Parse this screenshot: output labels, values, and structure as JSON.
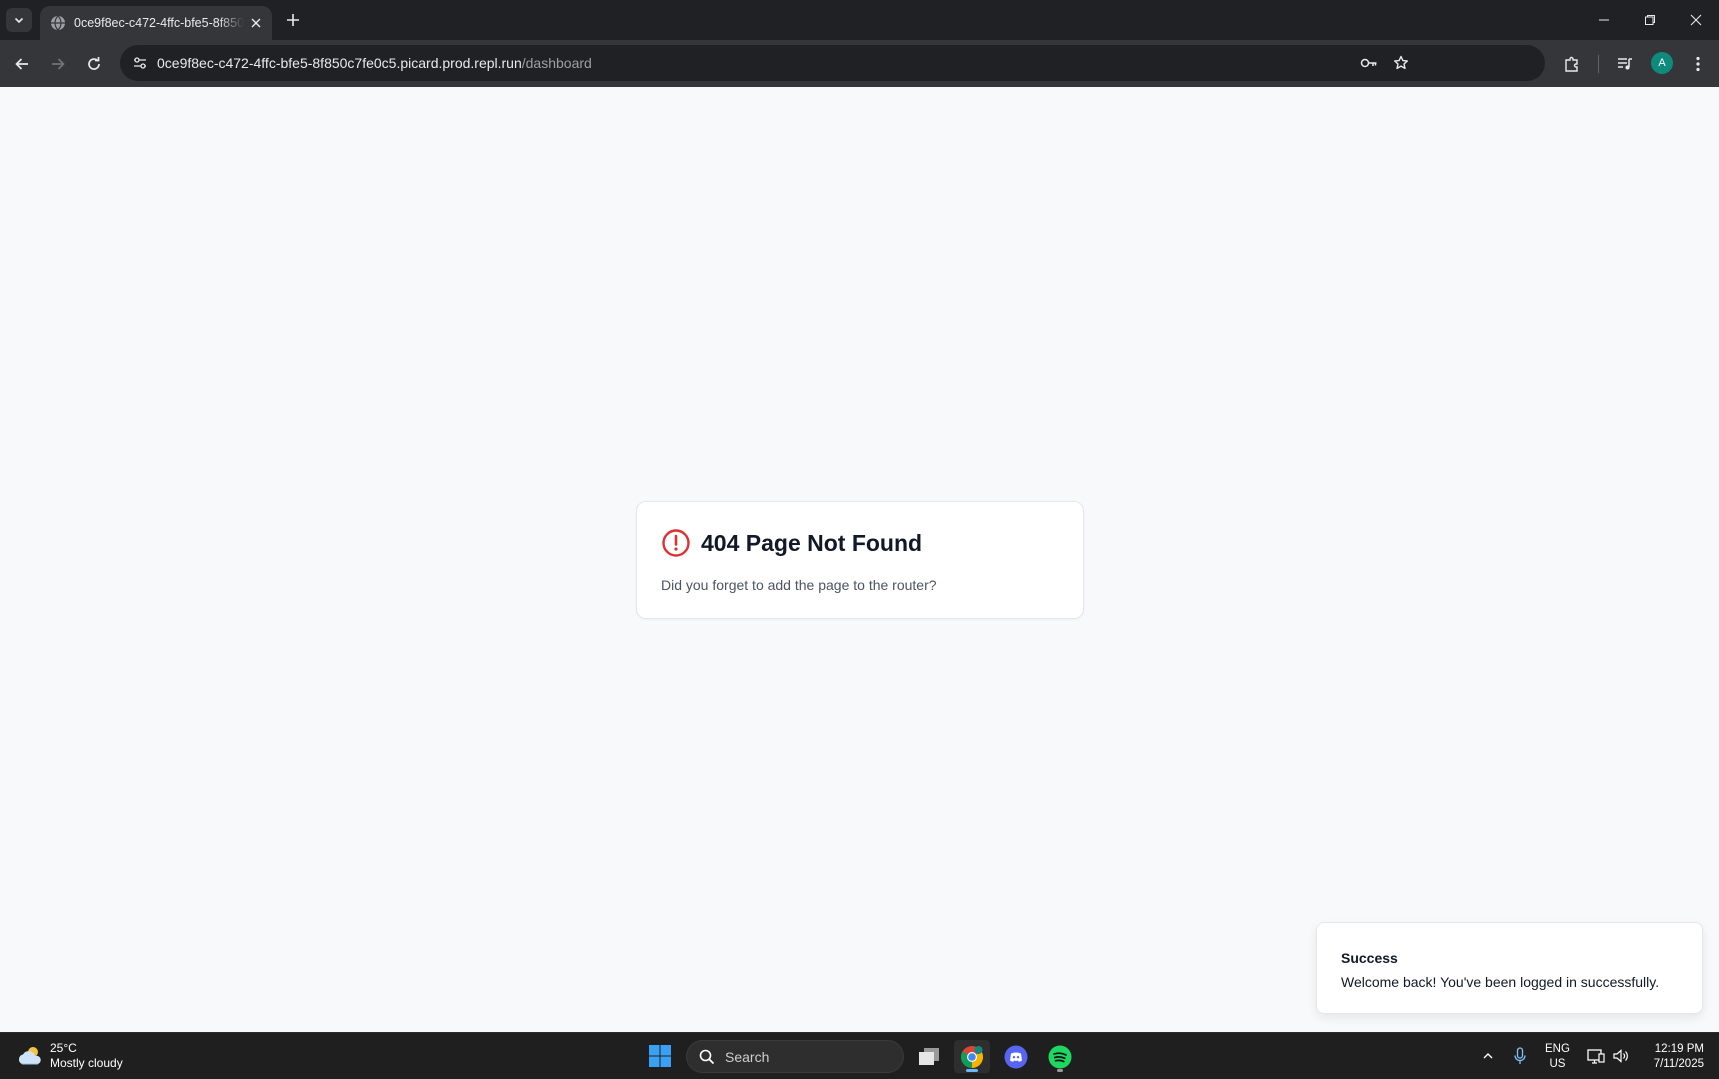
{
  "browser": {
    "tab_title": "0ce9f8ec-c472-4ffc-bfe5-8f850c7fe0c5",
    "url_host": "0ce9f8ec-c472-4ffc-bfe5-8f850c7fe0c5.picard.prod.repl.run",
    "url_path": "/dashboard",
    "profile_initial": "A"
  },
  "page": {
    "error_title": "404 Page Not Found",
    "error_description": "Did you forget to add the page to the router?"
  },
  "toast": {
    "title": "Success",
    "message": "Welcome back! You've been logged in successfully."
  },
  "taskbar": {
    "weather_temp": "25°C",
    "weather_desc": "Mostly cloudy",
    "search_placeholder": "Search",
    "lang_top": "ENG",
    "lang_bottom": "US",
    "time": "12:19 PM",
    "date": "7/11/2025"
  },
  "colors": {
    "error_red": "#e03131",
    "accent_blue": "#6cb5ff",
    "avatar": "#0f8b7d"
  }
}
